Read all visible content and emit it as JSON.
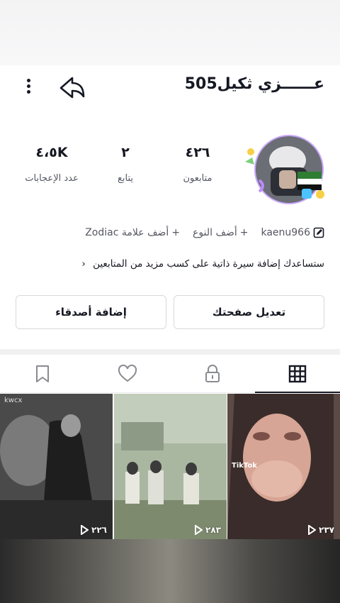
{
  "header": {
    "username": "عــــــزي ثكيل505"
  },
  "stats": [
    {
      "value": "٤٢٦",
      "label": "متابعون"
    },
    {
      "value": "٢",
      "label": "يتابع"
    },
    {
      "value": "٤،٥K",
      "label": "عدد الإعجابات"
    }
  ],
  "meta": {
    "handle": "kaenu966",
    "add_gender": "أضف النوع",
    "add_zodiac": "أضف علامة Zodiac"
  },
  "bio_hint": "ستساعدك إضافة سيرة ذاتية على كسب مزيد من المتابعين",
  "buttons": {
    "edit_profile": "تعديل صفحتك",
    "add_friends": "إضافة أصدقاء"
  },
  "videos": [
    {
      "views": "٢٢٦",
      "watermark": "kwcx"
    },
    {
      "views": "٢٨٣"
    },
    {
      "views": "٢٣٧",
      "watermark": "TikTok"
    }
  ]
}
